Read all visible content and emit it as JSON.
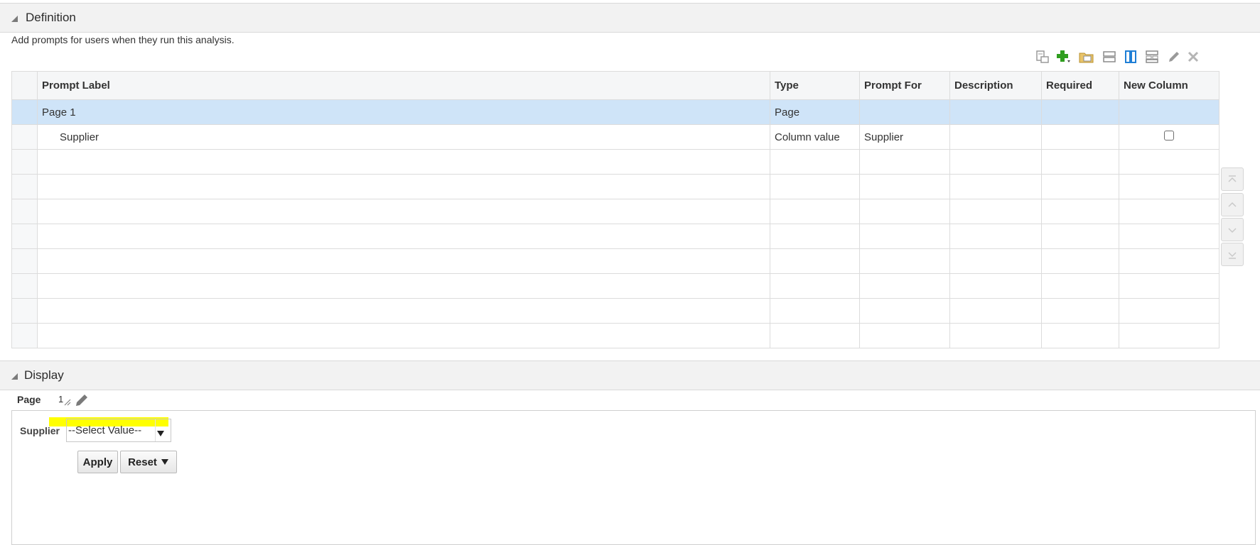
{
  "definition": {
    "title": "Definition",
    "description": "Add prompts for users when they run this analysis."
  },
  "toolbar": {
    "icons": [
      "preview-icon",
      "add-new-prompt-icon",
      "open-folder-icon",
      "row-layout-icon",
      "column-layout-icon",
      "grid-layout-icon",
      "edit-pencil-icon",
      "delete-x-icon"
    ]
  },
  "table": {
    "columns": [
      "Prompt Label",
      "Type",
      "Prompt For",
      "Description",
      "Required",
      "New Column"
    ],
    "rows": [
      {
        "label": "Page 1",
        "type": "Page",
        "prompt_for": "",
        "description": "",
        "required": "",
        "new_column": ""
      },
      {
        "label": "Supplier",
        "type": "Column value",
        "prompt_for": "Supplier",
        "description": "",
        "required": "",
        "new_column": ""
      }
    ],
    "new_column_checked": false
  },
  "display": {
    "title": "Display",
    "page_label": "Page",
    "page_value": "1",
    "prompt_label": "Supplier",
    "select_placeholder": "--Select Value--",
    "apply_label": "Apply",
    "reset_label": "Reset"
  },
  "colors": {
    "selected_row": "#cfe4f8",
    "highlight": "#ffff00",
    "add_icon": "#2f9e1f",
    "layout_icon": "#1f7fd6"
  }
}
